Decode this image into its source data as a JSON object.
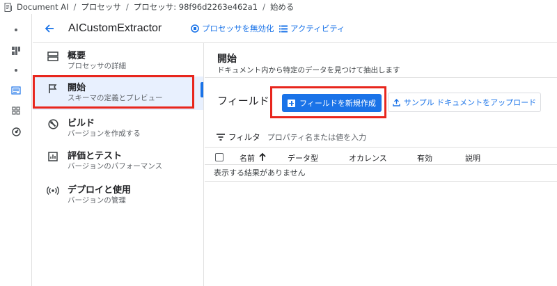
{
  "breadcrumb": {
    "items": [
      "Document AI",
      "プロセッサ",
      "プロセッサ: 98f96d2263e462a1",
      "始める"
    ],
    "separator": "/"
  },
  "header": {
    "title": "AICustomExtractor",
    "disable_label": "プロセッサを無効化",
    "activity_label": "アクティビティ"
  },
  "nav": {
    "items": [
      {
        "label": "概要",
        "sub": "プロセッサの詳細",
        "icon": "overview-icon"
      },
      {
        "label": "開始",
        "sub": "スキーマの定義とプレビュー",
        "icon": "flag-icon",
        "active": true
      },
      {
        "label": "ビルド",
        "sub": "バージョンを作成する",
        "icon": "build-icon"
      },
      {
        "label": "評価とテスト",
        "sub": "バージョンのパフォーマンス",
        "icon": "chart-icon"
      },
      {
        "label": "デプロイと使用",
        "sub": "バージョンの管理",
        "icon": "deploy-icon"
      }
    ]
  },
  "main": {
    "title": "開始",
    "description": "ドキュメント内から特定のデータを見つけて抽出します",
    "fields_heading": "フィールド",
    "create_button": "フィールドを新規作成",
    "upload_button": "サンプル ドキュメントをアップロード",
    "filter_label": "フィルタ",
    "filter_placeholder": "プロパティ名または値を入力",
    "columns": [
      "名前",
      "データ型",
      "オカレンス",
      "有効",
      "説明"
    ],
    "empty_text": "表示する結果がありません"
  },
  "colors": {
    "accent": "#1a73e8",
    "highlight": "#e8261d",
    "active_bg": "#e8f0fe"
  }
}
